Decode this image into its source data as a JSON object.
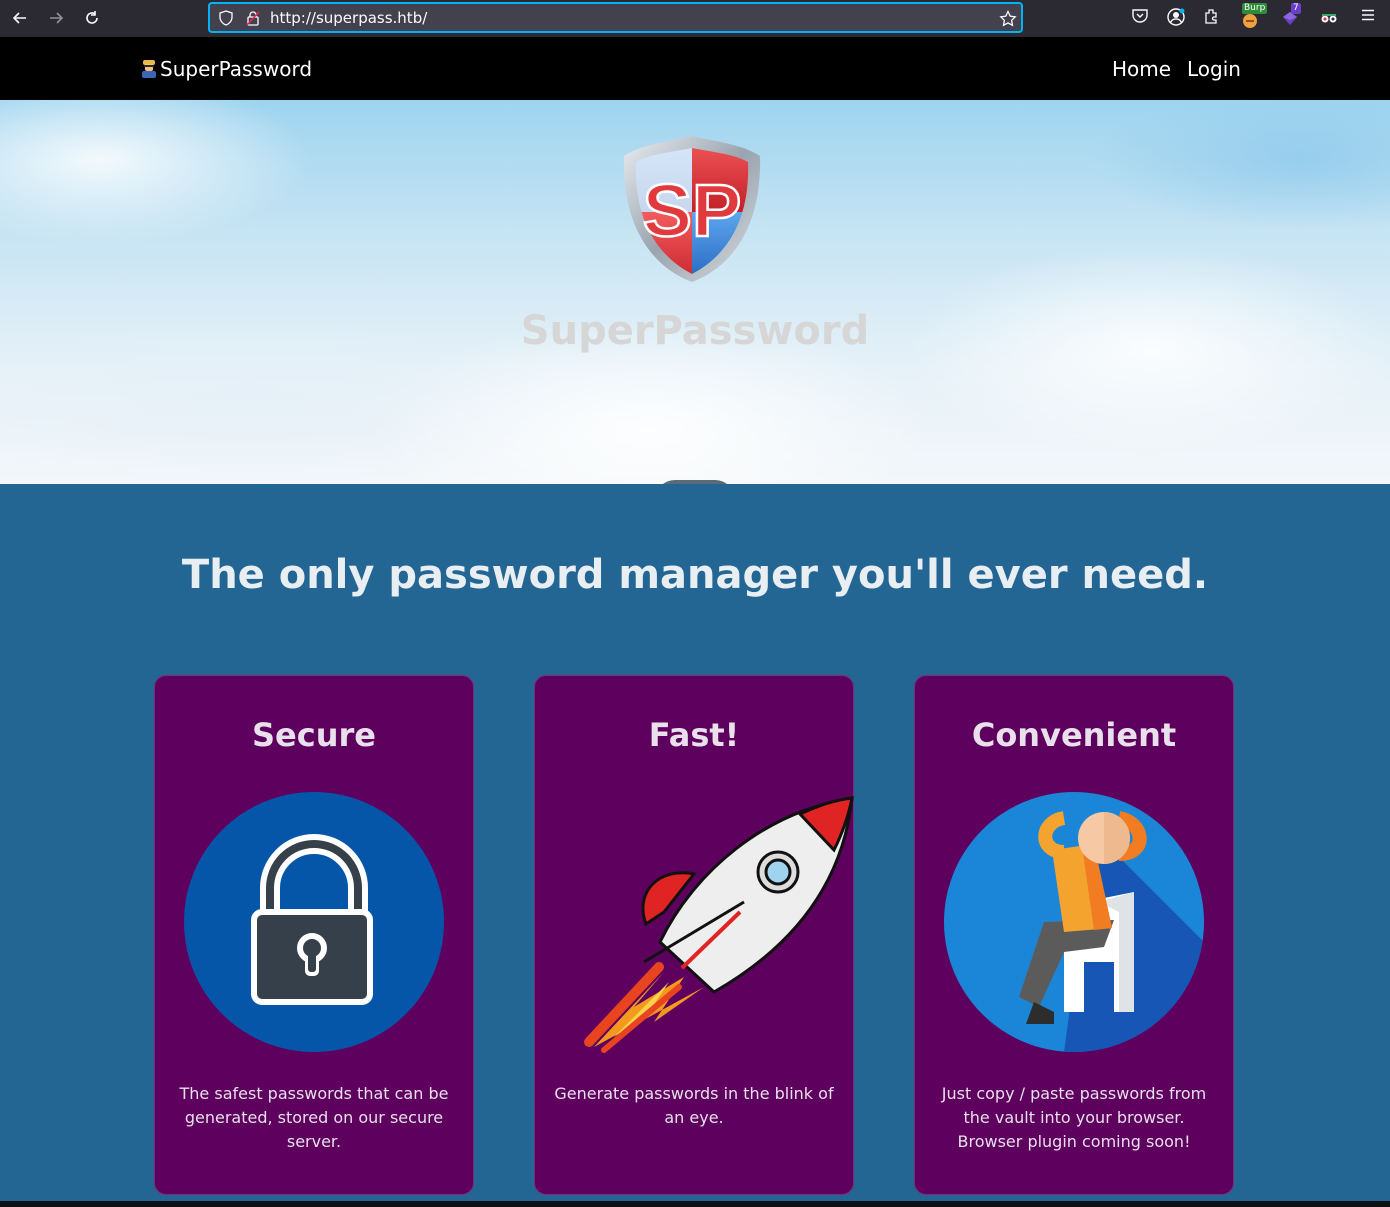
{
  "browser": {
    "back_icon": "arrow-left-icon",
    "forward_icon": "arrow-right-icon",
    "reload_icon": "reload-icon",
    "url": "http://superpass.htb/",
    "ext_burp_label": "Burp",
    "ext_badge_count": "7"
  },
  "navbar": {
    "brand": "SuperPassword",
    "links": [
      "Home",
      "Login"
    ]
  },
  "hero": {
    "logo_text": "SP",
    "title": "SuperPassword"
  },
  "main": {
    "tagline": "The only password manager you'll ever need.",
    "cards": [
      {
        "title": "Secure",
        "icon": "lock-icon",
        "text": "The safest passwords that can be generated, stored on our secure server."
      },
      {
        "title": "Fast!",
        "icon": "rocket-icon",
        "text": "Generate passwords in the blink of an eye."
      },
      {
        "title": "Convenient",
        "icon": "relaxing-person-icon",
        "text": "Just copy / paste passwords from the vault into your browser. Browser plugin coming soon!"
      }
    ]
  },
  "colors": {
    "navbar_bg": "#000000",
    "section_bg": "#236693",
    "card_bg": "#5e005e",
    "logo_red": "#e03a3e",
    "logo_blue": "#2f7fd6"
  }
}
